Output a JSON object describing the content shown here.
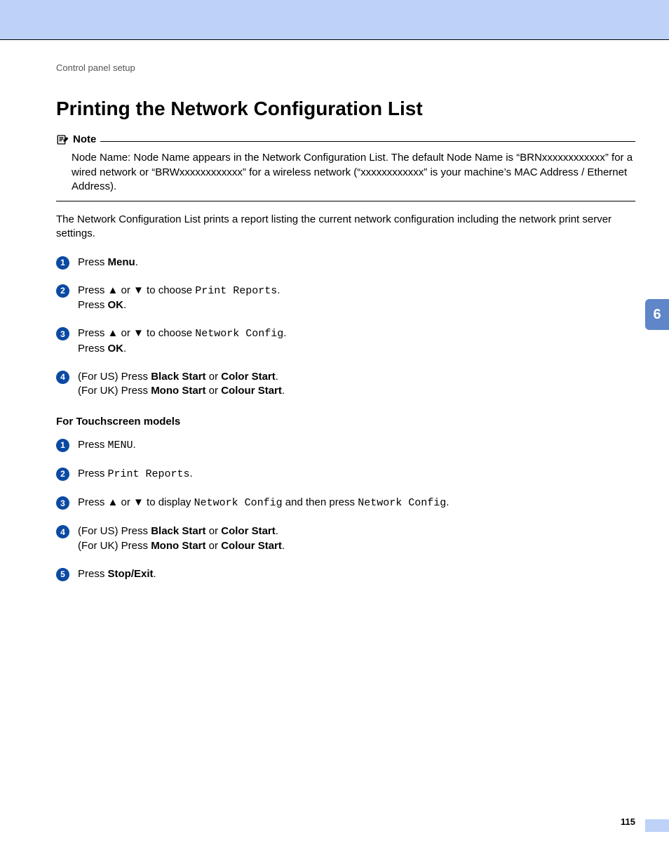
{
  "chrome": {
    "breadcrumb": "Control panel setup",
    "chapter_tab": "6",
    "page_number": "115"
  },
  "headings": {
    "title": "Printing the Network Configuration List",
    "note_label": "Note",
    "touchscreen": "For Touchscreen models"
  },
  "note": {
    "body_prefix": "Node Name: Node Name appears in the Network Configuration List. The default Node Name is “BRNxxxxxxxxxxxx” for a wired network or “BRWxxxxxxxxxxxx” for a wireless network (“xxxxxxxxxxxx” is your machine’s MAC Address / Ethernet Address)."
  },
  "intro": "The Network Configuration List prints a report listing the current network configuration including the network print server settings.",
  "text": {
    "press": "Press ",
    "menu": "Menu",
    "period": ".",
    "arrows_pre": "Press ▲ or ▼ to choose ",
    "arrows_display_pre": "Press ▲ or ▼ to display ",
    "and_then_press": " and then press ",
    "print_reports": "Print Reports",
    "network_config": "Network Config",
    "press_ok_line_pre": "Press ",
    "ok": "OK",
    "for_us_pre": "(For US) Press ",
    "for_uk_pre": "(For UK) Press ",
    "or": " or ",
    "black_start": "Black Start",
    "color_start": "Color Start",
    "mono_start": "Mono Start",
    "colour_start": "Colour Start",
    "menu_mono": "MENU",
    "stop_exit": "Stop/Exit"
  }
}
